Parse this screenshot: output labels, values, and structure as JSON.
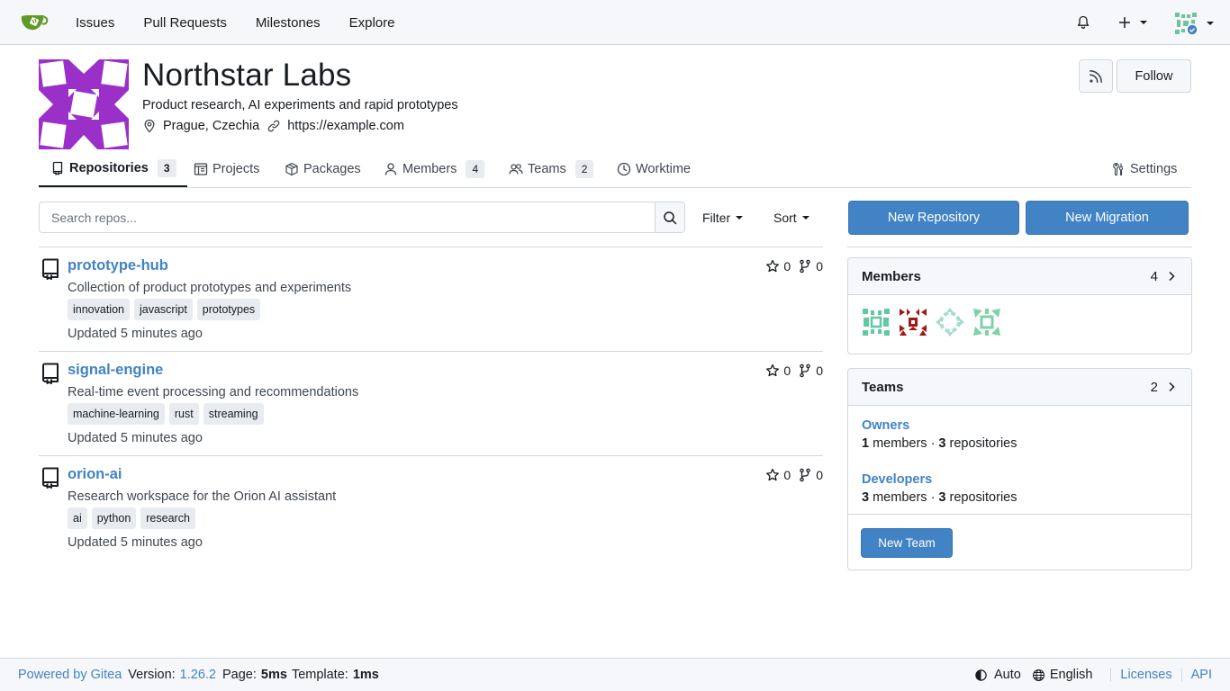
{
  "nav": {
    "links": [
      "Issues",
      "Pull Requests",
      "Milestones",
      "Explore"
    ]
  },
  "org": {
    "name": "Northstar Labs",
    "description": "Product research, AI experiments and rapid prototypes",
    "location": "Prague, Czechia",
    "website": "https://example.com",
    "follow_label": "Follow"
  },
  "tabs": {
    "repositories": {
      "label": "Repositories",
      "count": "3"
    },
    "projects": {
      "label": "Projects"
    },
    "packages": {
      "label": "Packages"
    },
    "members": {
      "label": "Members",
      "count": "4"
    },
    "teams": {
      "label": "Teams",
      "count": "2"
    },
    "worktime": {
      "label": "Worktime"
    },
    "settings": {
      "label": "Settings"
    }
  },
  "search": {
    "placeholder": "Search repos...",
    "filter_label": "Filter",
    "sort_label": "Sort"
  },
  "repos": [
    {
      "name": "prototype-hub",
      "description": "Collection of product prototypes and experiments",
      "topics": [
        "innovation",
        "javascript",
        "prototypes"
      ],
      "updated": "Updated 5 minutes ago",
      "stars": "0",
      "forks": "0"
    },
    {
      "name": "signal-engine",
      "description": "Real-time event processing and recommendations",
      "topics": [
        "machine-learning",
        "rust",
        "streaming"
      ],
      "updated": "Updated 5 minutes ago",
      "stars": "0",
      "forks": "0"
    },
    {
      "name": "orion-ai",
      "description": "Research workspace for the Orion AI assistant",
      "topics": [
        "ai",
        "python",
        "research"
      ],
      "updated": "Updated 5 minutes ago",
      "stars": "0",
      "forks": "0"
    }
  ],
  "actions": {
    "new_repository": "New Repository",
    "new_migration": "New Migration"
  },
  "members_panel": {
    "title": "Members",
    "count": "4"
  },
  "teams_panel": {
    "title": "Teams",
    "count": "2",
    "teams": [
      {
        "name": "Owners",
        "members": "1",
        "members_label": " members · ",
        "repos": "3",
        "repos_label": " repositories"
      },
      {
        "name": "Developers",
        "members": "3",
        "members_label": " members · ",
        "repos": "3",
        "repos_label": " repositories"
      }
    ],
    "new_team": "New Team"
  },
  "footer": {
    "powered": "Powered by Gitea",
    "version_label": "Version:",
    "version": "1.26.2",
    "page_label": "Page:",
    "page_time": "5ms",
    "template_label": "Template:",
    "template_time": "1ms",
    "theme": "Auto",
    "language": "English",
    "licenses": "Licenses",
    "api": "API"
  },
  "colors": {
    "accent": "#4183c4",
    "org_avatar": "#9b30c8"
  }
}
